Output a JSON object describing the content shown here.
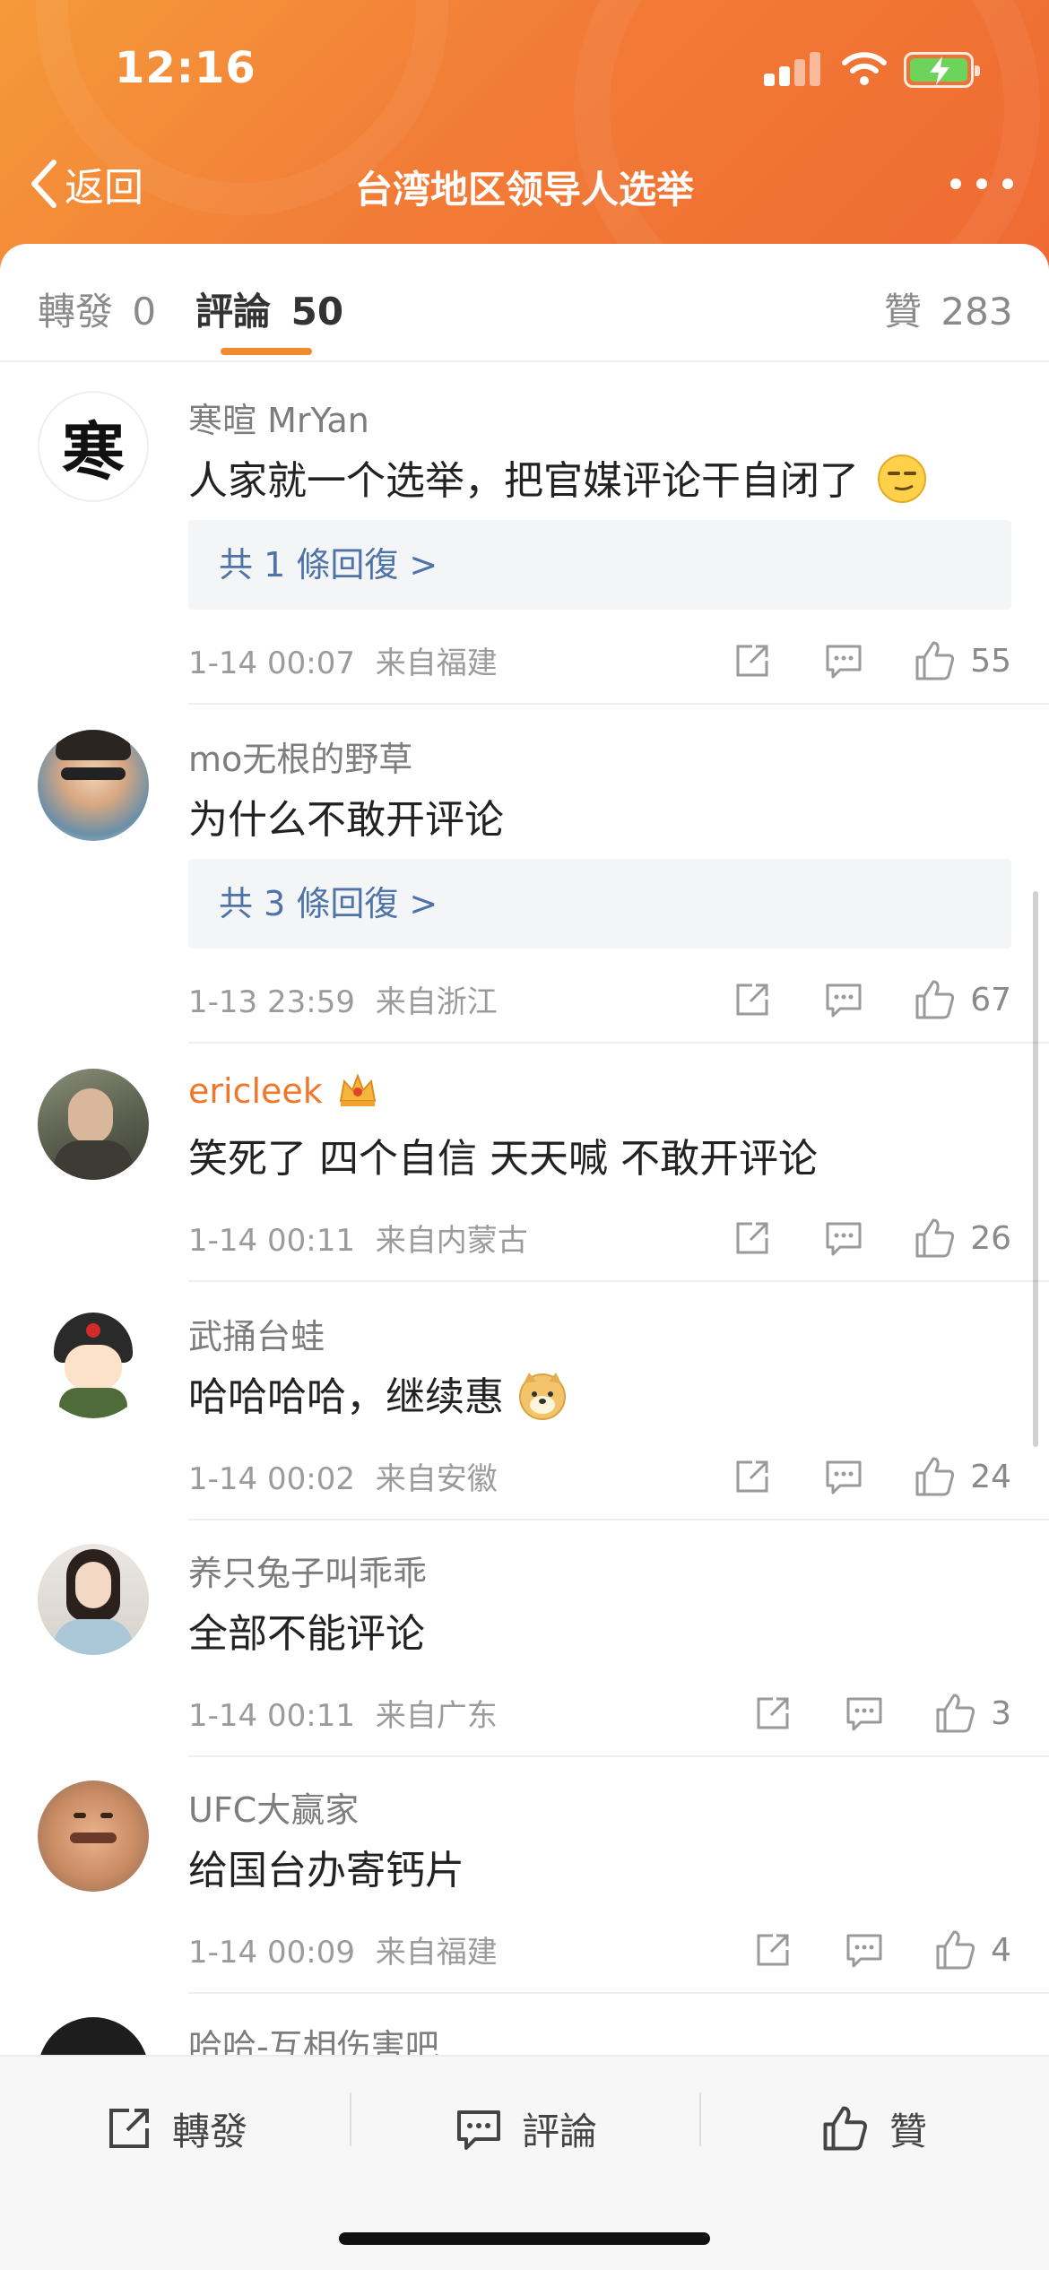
{
  "status_bar": {
    "time": "12:16"
  },
  "nav": {
    "back_label": "返回",
    "title": "台湾地区领导人选举"
  },
  "tabs": {
    "repost_label": "轉發",
    "repost_count": "0",
    "comment_label": "評論",
    "comment_count": "50",
    "like_label": "贊",
    "like_count": "283"
  },
  "comments": [
    {
      "name": "寒暄 MrYan",
      "text": "人家就一个选举，把官媒评论干自闭了",
      "emoji": "smirk-emoji",
      "replies": "共 1 條回復 >",
      "time": "1-14 00:07",
      "from": "来自福建",
      "likes": "55",
      "avatar_text": "寒"
    },
    {
      "name": "mo无根的野草",
      "text": "为什么不敢开评论",
      "replies": "共 3 條回復 >",
      "time": "1-13 23:59",
      "from": "来自浙江",
      "likes": "67"
    },
    {
      "name": "ericleek",
      "text": "笑死了 四个自信 天天喊 不敢开评论",
      "time": "1-14 00:11",
      "from": "来自内蒙古",
      "likes": "26"
    },
    {
      "name": "武捅台蛙",
      "text": "哈哈哈哈，继续惠",
      "emoji": "doge-emoji",
      "time": "1-14 00:02",
      "from": "来自安徽",
      "likes": "24"
    },
    {
      "name": "养只兔子叫乖乖",
      "text": "全部不能评论",
      "time": "1-14 00:11",
      "from": "来自广东",
      "likes": "3"
    },
    {
      "name": "UFC大赢家",
      "text": "给国台办寄钙片",
      "time": "1-14 00:09",
      "from": "来自福建",
      "likes": "4"
    },
    {
      "name": "哈哈-互相伤害吧"
    }
  ],
  "bottom_bar": {
    "repost": "轉發",
    "comment": "評論",
    "like": "贊"
  },
  "colors": {
    "accent": "#f28a2e",
    "header_start": "#f59a3a",
    "header_end": "#ef6a32",
    "link": "#4d73a9",
    "vip_name": "#f0762a"
  }
}
